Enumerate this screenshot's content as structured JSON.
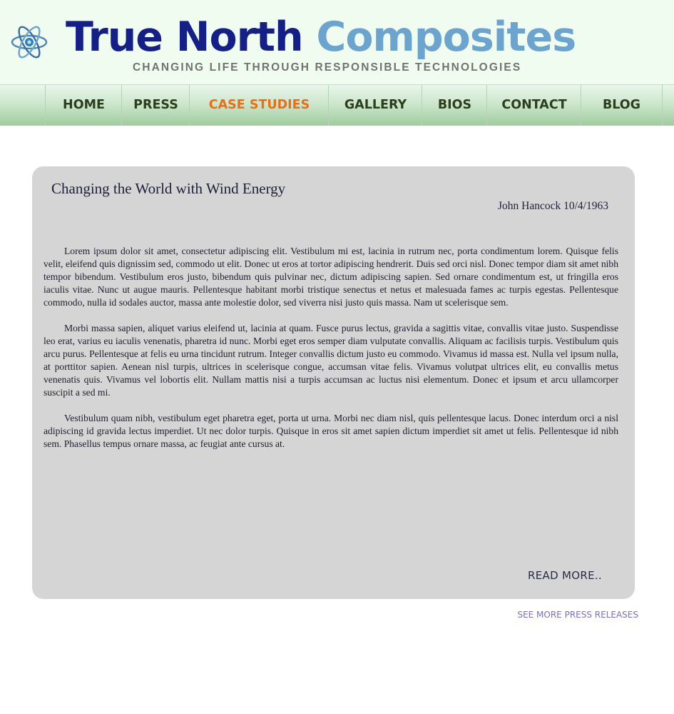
{
  "header": {
    "brand_word1": "True North",
    "brand_word2": "Composites",
    "tagline": "CHANGING LIFE THROUGH RESPONSIBLE TECHNOLOGIES",
    "logo_icon": "atom-icon"
  },
  "nav": {
    "items": [
      {
        "label": "HOME"
      },
      {
        "label": "PRESS"
      },
      {
        "label": "CASE STUDIES",
        "active": true
      },
      {
        "label": "GALLERY"
      },
      {
        "label": "BIOS"
      },
      {
        "label": "CONTACT"
      },
      {
        "label": "BLOG"
      }
    ]
  },
  "article": {
    "title": "Changing the World with Wind Energy",
    "byline": "John Hancock  10/4/1963",
    "paragraphs": [
      "Lorem ipsum dolor sit amet, consectetur adipiscing elit. Vestibulum mi est, lacinia in rutrum nec, porta condimentum lorem. Quisque felis velit, eleifend quis dignissim sed, commodo ut elit. Donec ut eros at tortor adipiscing hendrerit. Duis sed orci nisl. Donec tempor diam sit amet nibh tempor bibendum. Vestibulum eros justo, bibendum quis pulvinar nec, dictum adipiscing sapien. Sed ornare condimentum est, ut fringilla eros iaculis vitae. Nunc ut augue mauris. Pellentesque habitant morbi tristique senectus et netus et malesuada fames ac turpis egestas. Pellentesque commodo, nulla id sodales auctor, massa ante molestie dolor, sed viverra nisi justo quis massa. Nam ut scelerisque sem.",
      "Morbi massa sapien, aliquet varius eleifend ut, lacinia at quam. Fusce purus lectus, gravida a sagittis vitae, convallis vitae justo. Suspendisse leo erat, varius eu iaculis venenatis, pharetra id nunc. Morbi eget eros semper diam vulputate convallis. Aliquam ac facilisis turpis. Vestibulum quis arcu purus. Pellentesque at felis eu urna tincidunt rutrum. Integer convallis dictum justo eu commodo. Vivamus id massa est. Nulla vel ipsum nulla, at porttitor sapien. Aenean nisl turpis, ultrices in scelerisque congue, accumsan vitae felis. Vivamus volutpat ultrices elit, eu convallis metus venenatis quis. Vivamus vel lobortis elit. Nullam mattis nisi a turpis accumsan ac luctus nisi elementum. Donec et ipsum et arcu ullamcorper suscipit a sed mi.",
      "Vestibulum quam nibh, vestibulum eget pharetra eget, porta ut urna. Morbi nec diam nisl, quis pellentesque lacus. Donec interdum orci a nisl adipiscing id gravida lectus imperdiet. Ut nec dolor turpis. Quisque in eros sit amet sapien dictum imperdiet sit amet ut felis. Pellentesque id nibh sem. Phasellus tempus ornare massa, ac feugiat ante cursus at."
    ],
    "read_more": "READ MORE.."
  },
  "footer": {
    "see_more": "SEE MORE PRESS RELEASES"
  },
  "colors": {
    "brand_dark": "#141f88",
    "brand_light": "#6aa4cf",
    "nav_active": "#f06b12",
    "link": "#7a72b8"
  }
}
